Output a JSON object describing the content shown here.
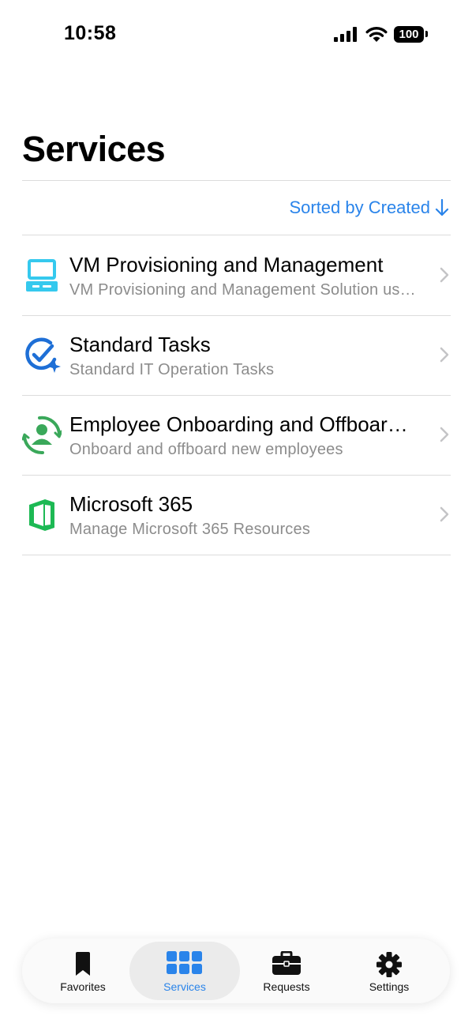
{
  "status_bar": {
    "time": "10:58",
    "battery": "100"
  },
  "header": {
    "title": "Services"
  },
  "sort": {
    "label": "Sorted by Created"
  },
  "services": [
    {
      "icon": "computer-icon",
      "title": "VM Provisioning and Management",
      "subtitle": "VM Provisioning and Management Solution us…"
    },
    {
      "icon": "check-sparkle-icon",
      "title": "Standard Tasks",
      "subtitle": "Standard IT Operation Tasks"
    },
    {
      "icon": "person-cycle-icon",
      "title": "Employee Onboarding and Offboar…",
      "subtitle": "Onboard and offboard new employees"
    },
    {
      "icon": "office-icon",
      "title": "Microsoft 365",
      "subtitle": "Manage Microsoft 365 Resources"
    }
  ],
  "tab_bar": {
    "tabs": [
      {
        "icon": "bookmark-icon",
        "label": "Favorites"
      },
      {
        "icon": "grid-icon",
        "label": "Services"
      },
      {
        "icon": "briefcase-icon",
        "label": "Requests"
      },
      {
        "icon": "gear-icon",
        "label": "Settings"
      }
    ],
    "active": "Services"
  },
  "colors": {
    "accent": "#2a84ea",
    "vm_icon": "#35c9ee",
    "tasks_icon": "#1e6fd6",
    "onboarding_icon": "#3aa85a",
    "office_icon": "#1db954"
  }
}
